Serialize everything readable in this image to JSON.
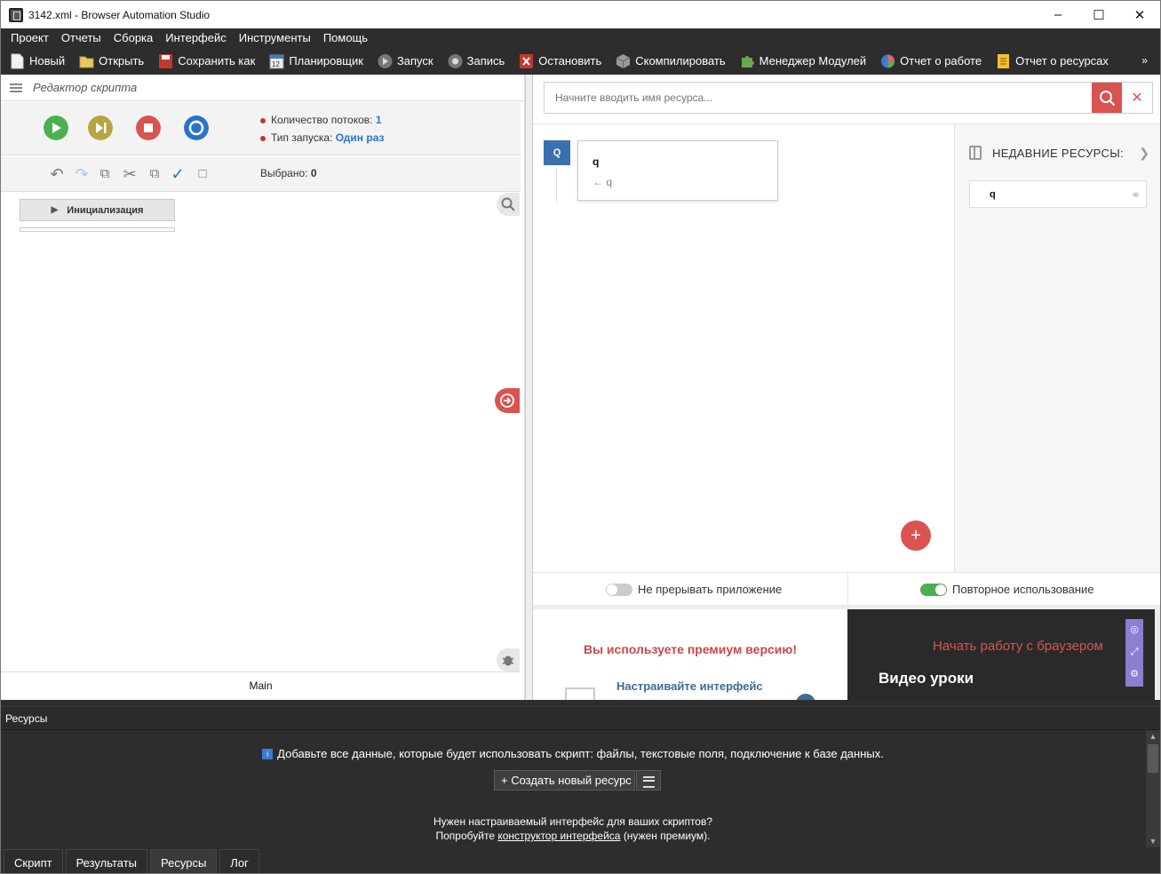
{
  "window": {
    "title": "3142.xml - Browser Automation Studio"
  },
  "menu": [
    "Проект",
    "Отчеты",
    "Сборка",
    "Интерфейс",
    "Инструменты",
    "Помощь"
  ],
  "toolbar": {
    "new": "Новый",
    "open": "Открыть",
    "save_as": "Сохранить как",
    "scheduler": "Планировщик",
    "run": "Запуск",
    "record": "Запись",
    "stop": "Остановить",
    "compile": "Скомпилировать",
    "modules": "Менеджер Модулей",
    "work_report": "Отчет о работе",
    "resource_report": "Отчет о ресурсах",
    "more": "»"
  },
  "editor": {
    "title": "Редактор скрипта",
    "threads_label": "Количество потоков:",
    "threads_value": "1",
    "launch_label": "Тип запуска:",
    "launch_value": "Один раз",
    "selected_label": "Выбрано:",
    "selected_value": "0",
    "init_block": "Инициализация",
    "main_tab": "Main"
  },
  "resources": {
    "search_placeholder": "Начните вводить имя ресурса...",
    "item_badge": "Q",
    "item_name": "q",
    "item_sub": "← q",
    "recent_title": "НЕДАВНИЕ РЕСУРСЫ:",
    "recent_item": "q",
    "opt_no_interrupt": "Не прерывать приложение",
    "opt_reuse": "Повторное использование",
    "plus": "+"
  },
  "preview": {
    "premium": "Вы используете премиум версию!",
    "customize": "Настраивайте интерфейс",
    "start_browser": "Начать работу с браузером",
    "video": "Видео уроки"
  },
  "dock": {
    "title": "Ресурсы",
    "hint": "Добавьте все данные, которые будет использовать скрипт: файлы, текстовые поля, подключение к базе данных.",
    "create": "+ Создать новый ресурс",
    "need_line1": "Нужен настраиваемый интерфейс для ваших скриптов?",
    "need_pre": "Попробуйте",
    "need_link": "конструктор интерфейса",
    "need_post": "(нужен премиум)."
  },
  "bottom_tabs": [
    "Скрипт",
    "Результаты",
    "Ресурсы",
    "Лог"
  ],
  "colors": {
    "accent_red": "#d9534f",
    "accent_blue": "#2a73c9",
    "dark_bg": "#2d2d2d",
    "toggle_on": "#4caf50"
  }
}
